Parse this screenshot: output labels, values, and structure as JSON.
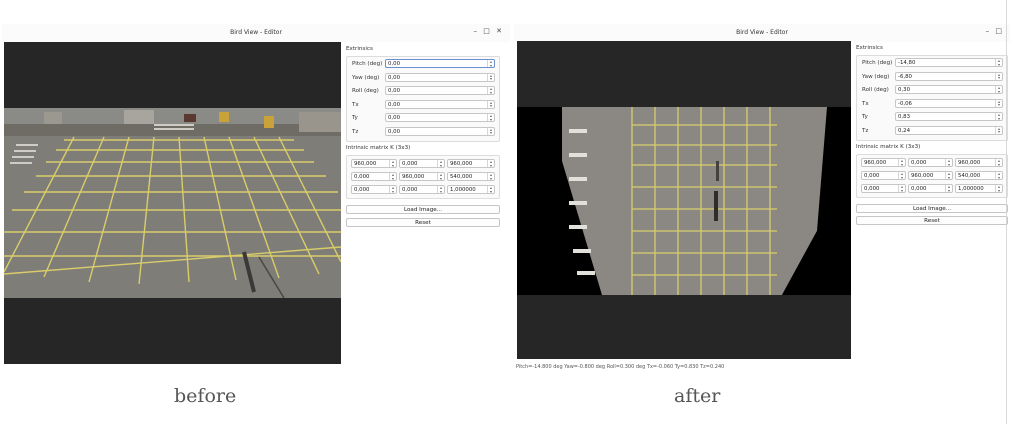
{
  "before": {
    "window_title": "Bird View - Editor",
    "extrinsics": {
      "title": "Extrinsics",
      "fields": [
        {
          "label": "Pitch (deg)",
          "value": "0,00"
        },
        {
          "label": "Yaw (deg)",
          "value": "0,00"
        },
        {
          "label": "Roll (deg)",
          "value": "0,00"
        },
        {
          "label": "Tx",
          "value": "0,00"
        },
        {
          "label": "Ty",
          "value": "0,00"
        },
        {
          "label": "Tz",
          "value": "0,00"
        }
      ]
    },
    "intrinsics": {
      "title": "Intrinsic matrix K (3x3)",
      "rows": [
        [
          "960,000",
          "0,000",
          "960,000"
        ],
        [
          "0,000",
          "960,000",
          "540,000"
        ],
        [
          "0,000",
          "0,000",
          "1,000000"
        ]
      ]
    },
    "load_label": "Load Image...",
    "reset_label": "Reset"
  },
  "after": {
    "window_title": "Bird View - Editor",
    "extrinsics": {
      "title": "Extrinsics",
      "fields": [
        {
          "label": "Pitch (deg)",
          "value": "-14,80"
        },
        {
          "label": "Yaw (deg)",
          "value": "-6,80"
        },
        {
          "label": "Roll (deg)",
          "value": "0,30"
        },
        {
          "label": "Tx",
          "value": "-0,06"
        },
        {
          "label": "Ty",
          "value": "0,83"
        },
        {
          "label": "Tz",
          "value": "0,24"
        }
      ]
    },
    "intrinsics": {
      "title": "Intrinsic matrix K (3x3)",
      "rows": [
        [
          "960,000",
          "0,000",
          "960,000"
        ],
        [
          "0,000",
          "960,000",
          "540,000"
        ],
        [
          "0,000",
          "0,000",
          "1,000000"
        ]
      ]
    },
    "load_label": "Load Image...",
    "reset_label": "Reset",
    "status": "Pitch=-14.800 deg  Yaw=-0.800 deg  Roll=0.300 deg  Tx=-0.060  Ty=0.830  Tz=0.240"
  },
  "captions": {
    "before": "before",
    "after": "after"
  },
  "icons": {
    "minimize": "minimize-icon",
    "maximize": "maximize-icon",
    "close": "close-icon"
  }
}
